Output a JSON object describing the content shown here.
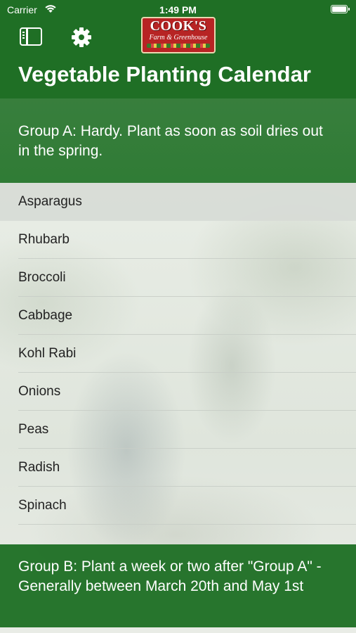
{
  "status_bar": {
    "carrier": "Carrier",
    "time": "1:49 PM"
  },
  "toolbar": {
    "sidebar_icon": "sidebar-icon",
    "settings_icon": "gear-icon"
  },
  "logo": {
    "title": "COOK'S",
    "subtitle": "Farm & Greenhouse"
  },
  "page": {
    "title": "Vegetable Planting Calendar"
  },
  "groups": [
    {
      "header": "Group A: Hardy. Plant as soon as soil dries out in the spring.",
      "items": [
        "Asparagus",
        "Rhubarb",
        "Broccoli",
        "Cabbage",
        "Kohl Rabi",
        "Onions",
        "Peas",
        "Radish",
        "Spinach"
      ],
      "selected_index": 0
    },
    {
      "header": "Group B: Plant a week or two after \"Group A\" - Generally between March 20th and May 1st",
      "items": []
    }
  ],
  "colors": {
    "header_green": "#1f6f25",
    "text": "#222222",
    "selected_row": "#d7dbd6"
  }
}
